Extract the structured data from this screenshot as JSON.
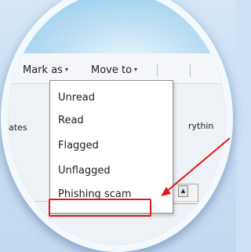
{
  "toolbar": {
    "partial_left_caret": "▾",
    "mark_as": "Mark as",
    "move_to": "Move to",
    "caret": "▾"
  },
  "background": {
    "left_label": "ates",
    "right_label": "rythin"
  },
  "mark_as_menu": {
    "items": [
      "Unread",
      "Read",
      "Flagged",
      "Unflagged",
      "Phishing scam"
    ],
    "highlighted": "Phishing scam"
  },
  "annotation": {
    "color": "#e01a1a"
  }
}
